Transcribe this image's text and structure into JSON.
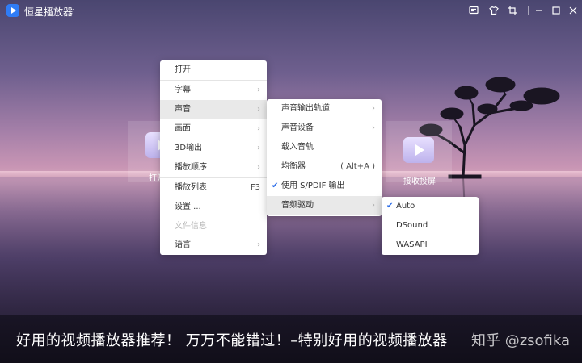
{
  "app": {
    "title": "恒星播放器"
  },
  "tiles": {
    "left_label": "打开",
    "right_label": "接收投屏"
  },
  "main_menu": {
    "items": [
      {
        "label": "打开"
      },
      {
        "label": "字幕"
      },
      {
        "label": "声音"
      },
      {
        "label": "画面"
      },
      {
        "label": "3D输出"
      },
      {
        "label": "播放顺序"
      },
      {
        "label": "播放列表",
        "shortcut": "F3"
      },
      {
        "label": "设置 ..."
      },
      {
        "label": "文件信息"
      },
      {
        "label": "语言"
      }
    ]
  },
  "sound_menu": {
    "items": [
      {
        "label": "声音输出轨道"
      },
      {
        "label": "声音设备"
      },
      {
        "label": "载入音轨"
      },
      {
        "label": "均衡器",
        "shortcut": "( Alt+A )"
      },
      {
        "label": "使用 S/PDIF 输出"
      },
      {
        "label": "音频驱动"
      }
    ]
  },
  "driver_menu": {
    "items": [
      {
        "label": "Auto"
      },
      {
        "label": "DSound"
      },
      {
        "label": "WASAPI"
      }
    ]
  },
  "caption": {
    "text": "好用的视频播放器推荐！ 万万不能错过！–特别好用的视频播放器",
    "watermark": "知乎 @zsofika"
  }
}
